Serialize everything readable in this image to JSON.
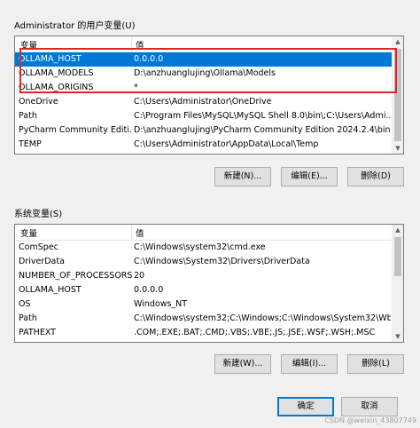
{
  "user_group": {
    "title": "Administrator 的用户变量(U)",
    "header": {
      "name": "变量",
      "value": "值"
    },
    "rows": [
      {
        "name": "OLLAMA_HOST",
        "value": "0.0.0.0"
      },
      {
        "name": "OLLAMA_MODELS",
        "value": "D:\\anzhuanglujing\\Ollama\\Models"
      },
      {
        "name": "OLLAMA_ORIGINS",
        "value": "*"
      },
      {
        "name": "OneDrive",
        "value": "C:\\Users\\Administrator\\OneDrive"
      },
      {
        "name": "Path",
        "value": "C:\\Program Files\\MySQL\\MySQL Shell 8.0\\bin\\;C:\\Users\\Admi..."
      },
      {
        "name": "PyCharm Community Editi...",
        "value": "D:\\anzhuanglujing\\PyCharm Community Edition 2024.2.4\\bin;"
      },
      {
        "name": "TEMP",
        "value": "C:\\Users\\Administrator\\AppData\\Local\\Temp"
      }
    ],
    "selected_index": 0,
    "buttons": {
      "new": "新建(N)...",
      "edit": "编辑(E)...",
      "delete": "删除(D)"
    }
  },
  "system_group": {
    "title": "系统变量(S)",
    "header": {
      "name": "变量",
      "value": "值"
    },
    "rows": [
      {
        "name": "ComSpec",
        "value": "C:\\Windows\\system32\\cmd.exe"
      },
      {
        "name": "DriverData",
        "value": "C:\\Windows\\System32\\Drivers\\DriverData"
      },
      {
        "name": "NUMBER_OF_PROCESSORS",
        "value": "20"
      },
      {
        "name": "OLLAMA_HOST",
        "value": "0.0.0.0"
      },
      {
        "name": "OS",
        "value": "Windows_NT"
      },
      {
        "name": "Path",
        "value": "C:\\Windows\\system32;C:\\Windows;C:\\Windows\\System32\\Wb..."
      },
      {
        "name": "PATHEXT",
        "value": ".COM;.EXE;.BAT;.CMD;.VBS;.VBE;.JS;.JSE;.WSF;.WSH;.MSC"
      }
    ],
    "buttons": {
      "new": "新建(W)...",
      "edit": "编辑(I)...",
      "delete": "删除(L)"
    }
  },
  "footer": {
    "ok": "确定",
    "cancel": "取消"
  },
  "watermark": "CSDN @weixin_43807749",
  "colors": {
    "selection": "#0078d7",
    "annotation_box": "#e3242b",
    "window_bg": "#f0f0f0"
  }
}
